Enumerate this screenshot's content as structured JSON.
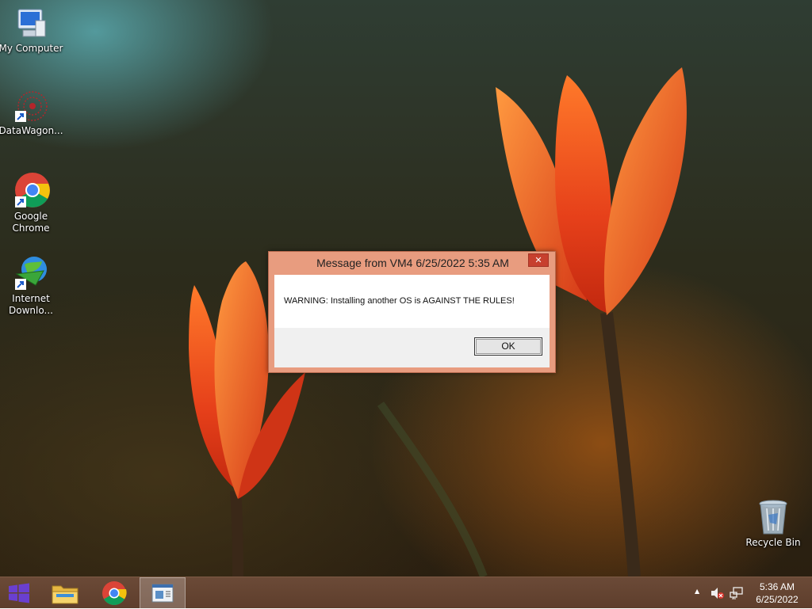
{
  "desktop": {
    "icons": [
      {
        "label": "My Computer"
      },
      {
        "label": "DataWagon..."
      },
      {
        "label": "Google Chrome"
      },
      {
        "label": "Internet Downlo..."
      },
      {
        "label": "Recycle Bin"
      }
    ]
  },
  "dialog": {
    "title": "Message from VM4 6/25/2022 5:35 AM",
    "close_glyph": "✕",
    "message": "WARNING: Installing another OS is AGAINST THE RULES!",
    "ok_label": "OK"
  },
  "taskbar": {
    "pinned": [
      {
        "icon": "windows-start-icon"
      },
      {
        "icon": "file-explorer-icon"
      },
      {
        "icon": "chrome-icon"
      },
      {
        "icon": "message-window-icon"
      }
    ],
    "tray": {
      "show_hidden_glyph": "▲",
      "icons": [
        "volume-muted-icon",
        "network-icon"
      ]
    },
    "clock": {
      "time": "5:36 AM",
      "date": "6/25/2022"
    }
  },
  "colors": {
    "taskbar": "#5e3e2c",
    "dialog_frame": "#e89c7f",
    "close_button": "#c7402e",
    "start_icon": "#6a3fd0"
  }
}
